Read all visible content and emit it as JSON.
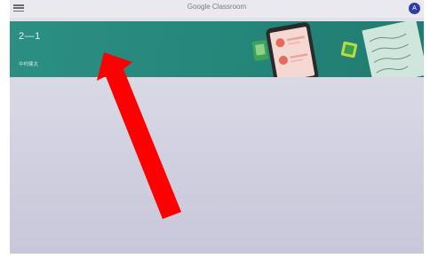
{
  "app": {
    "title": "Google Classroom",
    "avatar_letter": "A"
  },
  "icons": {
    "menu": "hamburger-menu-icon",
    "illustration": "class-banner-illustration"
  },
  "class_card": {
    "name": "2—1",
    "teacher": "中村健太"
  },
  "colors": {
    "banner": "#26887c",
    "avatar": "#2f3ea5",
    "annotation_arrow": "#ff0000"
  }
}
